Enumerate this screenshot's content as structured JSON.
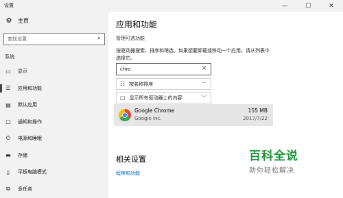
{
  "window": {
    "title": "设置"
  },
  "sidebar": {
    "home_label": "主页",
    "search_placeholder": "查找设置",
    "section_label": "系统",
    "items": [
      {
        "label": "显示",
        "icon": "display-icon"
      },
      {
        "label": "应用和功能",
        "icon": "apps-icon"
      },
      {
        "label": "默认应用",
        "icon": "default-apps-icon"
      },
      {
        "label": "通知和操作",
        "icon": "notifications-icon"
      },
      {
        "label": "电源和睡眠",
        "icon": "power-icon"
      },
      {
        "label": "存储",
        "icon": "storage-icon"
      },
      {
        "label": "平板电脑模式",
        "icon": "tablet-icon"
      },
      {
        "label": "多任务",
        "icon": "multitasking-icon"
      }
    ]
  },
  "main": {
    "title": "应用和功能",
    "subtitle": "管理可选功能",
    "description": "按驱动器搜索、排序和筛选。如果想要卸载或移动一个应用，请从列表中选择它。",
    "search_value": "chro",
    "sort_label": "按名称排序",
    "filter_label": "显示所有驱动器上的内容",
    "apps": [
      {
        "name": "Google Chrome",
        "publisher": "Google Inc.",
        "size": "155 MB",
        "date": "2017/7/22"
      }
    ],
    "related_title": "相关设置",
    "related_link": "程序和功能"
  },
  "watermark": {
    "main": "百科全说",
    "sub": "助你轻松解决"
  }
}
